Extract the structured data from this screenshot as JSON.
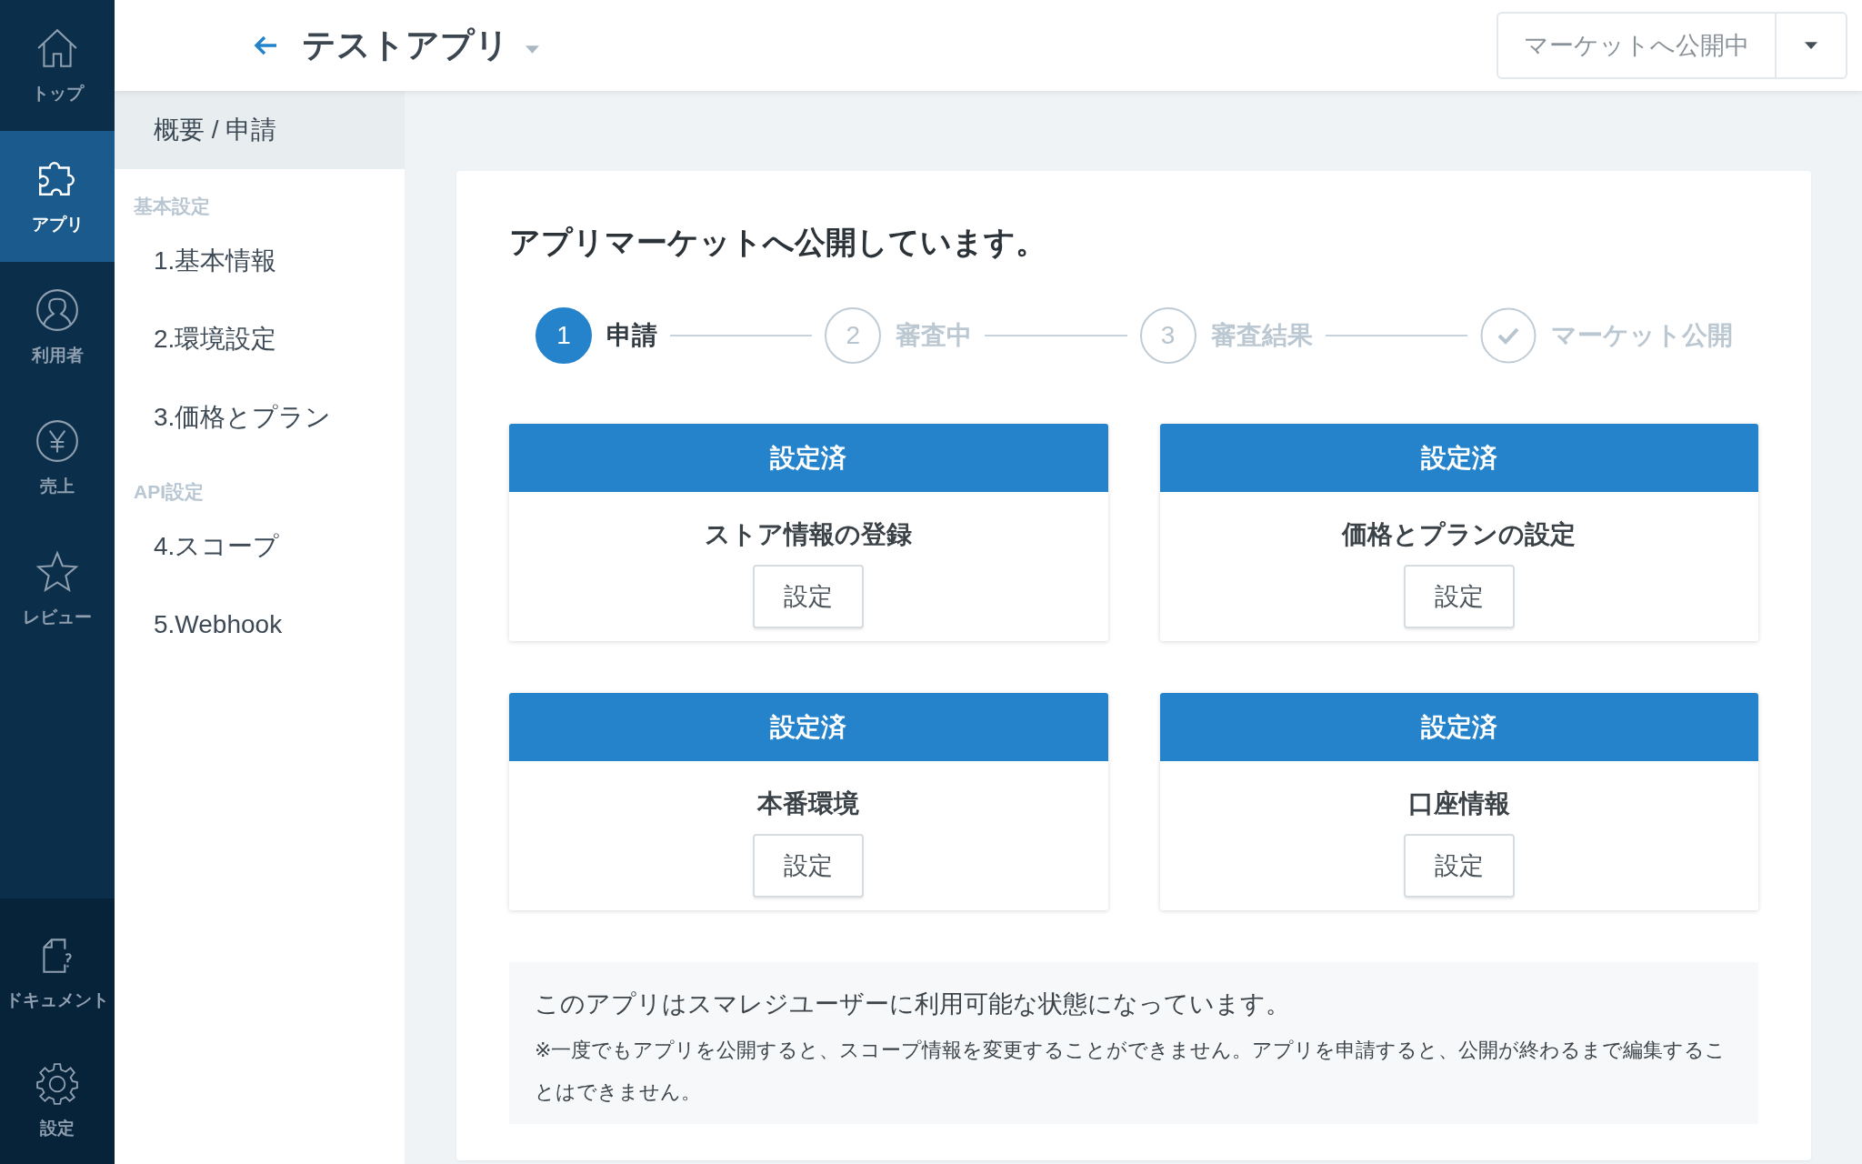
{
  "nav": {
    "items": [
      {
        "label": "トップ",
        "selected": false
      },
      {
        "label": "アプリ",
        "selected": true
      },
      {
        "label": "利用者",
        "selected": false
      },
      {
        "label": "売上",
        "selected": false
      },
      {
        "label": "レビュー",
        "selected": false
      }
    ],
    "footer_items": [
      {
        "label": "ドキュメント",
        "selected": false
      },
      {
        "label": "設定",
        "selected": false
      }
    ]
  },
  "header": {
    "title": "テストアプリ",
    "status_button": "マーケットへ公開中"
  },
  "sidebar": {
    "top_item": {
      "label": "概要 / 申請",
      "selected": true
    },
    "sections": [
      {
        "title": "基本設定",
        "items": [
          {
            "label": "1.基本情報",
            "selected": false
          },
          {
            "label": "2.環境設定",
            "selected": false
          },
          {
            "label": "3.価格とプラン",
            "selected": false
          }
        ]
      },
      {
        "title": "API設定",
        "items": [
          {
            "label": "4.スコープ",
            "selected": false
          },
          {
            "label": "5.Webhook",
            "selected": false
          }
        ]
      }
    ]
  },
  "main": {
    "heading": "アプリマーケットへ公開しています。",
    "steps": [
      {
        "kind": "number",
        "marker": "1",
        "label": "申請",
        "selected": true
      },
      {
        "kind": "number",
        "marker": "2",
        "label": "審査中",
        "selected": false
      },
      {
        "kind": "number",
        "marker": "3",
        "label": "審査結果",
        "selected": false
      },
      {
        "kind": "check",
        "label": "マーケット公開",
        "selected": false
      }
    ],
    "tasks": [
      {
        "status": "設定済",
        "title": "ストア情報の登録",
        "button": "設定"
      },
      {
        "status": "設定済",
        "title": "価格とプランの設定",
        "button": "設定"
      },
      {
        "status": "設定済",
        "title": "本番環境",
        "button": "設定"
      },
      {
        "status": "設定済",
        "title": "口座情報",
        "button": "設定"
      }
    ],
    "notice": {
      "message": "このアプリはスマレジユーザーに利用可能な状態になっています。",
      "note": "※一度でもアプリを公開すると、スコープ情報を変更することができません。アプリを申請すると、公開が終わるまで編集することはできません。"
    }
  }
}
